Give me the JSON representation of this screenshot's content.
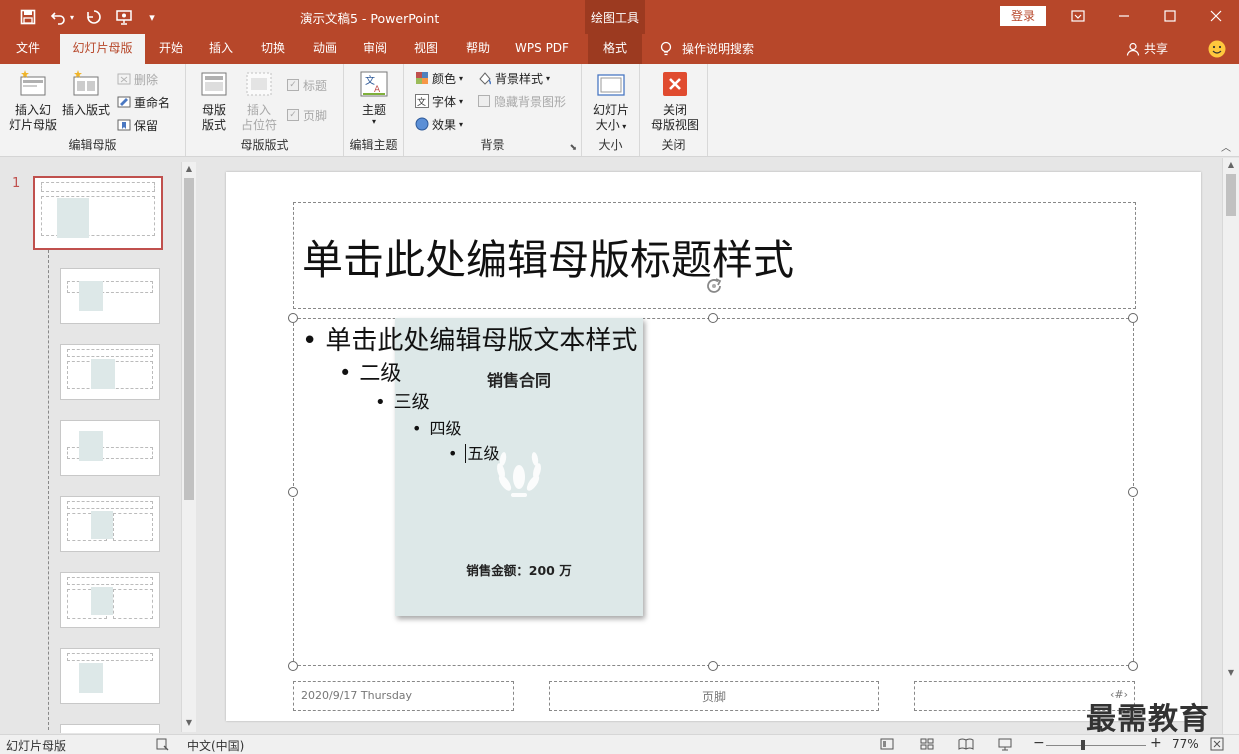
{
  "quick_access": {
    "save_icon": "save-icon",
    "undo_icon": "undo-icon",
    "redo_icon": "redo-icon",
    "present_icon": "present-from-start-icon",
    "customize_icon": "customize-qat-icon"
  },
  "window": {
    "title": "演示文稿5  -  PowerPoint",
    "context_tool_group": "绘图工具",
    "login_label": "登录"
  },
  "tabs": [
    {
      "label": "文件"
    },
    {
      "label": "幻灯片母版"
    },
    {
      "label": "开始"
    },
    {
      "label": "插入"
    },
    {
      "label": "切换"
    },
    {
      "label": "动画"
    },
    {
      "label": "审阅"
    },
    {
      "label": "视图"
    },
    {
      "label": "帮助"
    },
    {
      "label": "WPS PDF"
    },
    {
      "label": "格式"
    }
  ],
  "tell_me": "操作说明搜索",
  "share": "共享",
  "ribbon": {
    "edit_master": {
      "label": "编辑母版",
      "insert_master_line1": "插入幻",
      "insert_master_line2": "灯片母版",
      "insert_layout": "插入版式",
      "delete": "删除",
      "rename": "重命名",
      "preserve": "保留"
    },
    "master_layout": {
      "label": "母版版式",
      "master_layout_line1": "母版",
      "master_layout_line2": "版式",
      "insert_placeholder_line1": "插入",
      "insert_placeholder_line2": "占位符",
      "title": "标题",
      "footers": "页脚"
    },
    "edit_theme": {
      "label": "编辑主题",
      "themes": "主题"
    },
    "background": {
      "label": "背景",
      "colors": "颜色",
      "fonts": "字体",
      "effects": "效果",
      "background_styles": "背景样式",
      "hide_background": "隐藏背景图形"
    },
    "size": {
      "label": "大小",
      "slide_size_line1": "幻灯片",
      "slide_size_line2": "大小"
    },
    "close": {
      "label": "关闭",
      "close_line1": "关闭",
      "close_line2": "母版视图"
    }
  },
  "thumbnails": {
    "first_number": "1"
  },
  "slide": {
    "title": "单击此处编辑母版标题样式",
    "body": {
      "level1": "单击此处编辑母版文本样式",
      "level2": "二级",
      "level3": "三级",
      "level4": "四级",
      "level5": "五级"
    },
    "card_title": "销售合同",
    "card_amount": "销售金额：200 万",
    "footer_date": "2020/9/17 Thursday",
    "footer_center": "页脚",
    "footer_number": "‹#›"
  },
  "status": {
    "view": "幻灯片母版",
    "language": "中文(中国)",
    "zoom": "77%"
  },
  "watermark": "最需教育",
  "colors": {
    "accent": "#b7472a",
    "card_bg": "#dde8e8",
    "selection": "#c0504d"
  }
}
